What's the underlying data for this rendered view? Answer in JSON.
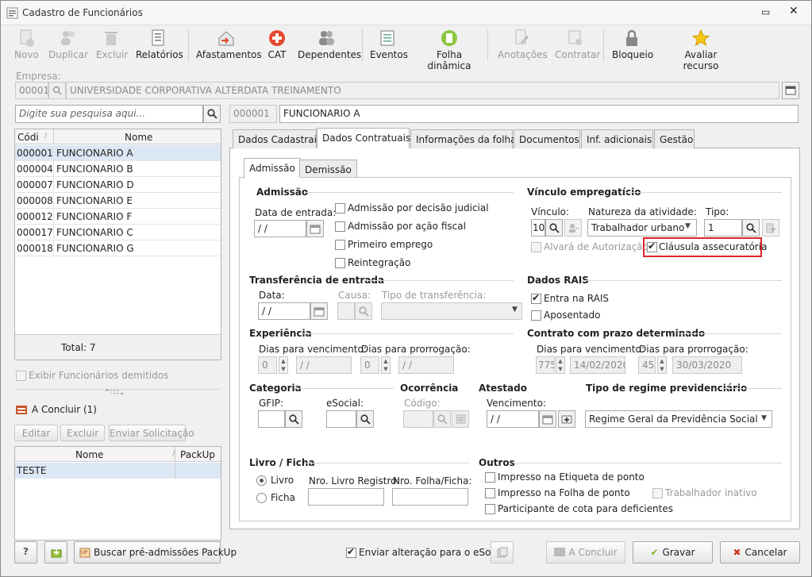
{
  "window": {
    "title": "Cadastro de Funcionários"
  },
  "toolbar": [
    {
      "label": "Novo",
      "icon": "new-document-icon",
      "enabled": false
    },
    {
      "label": "Duplicar",
      "icon": "users-icon",
      "enabled": false
    },
    {
      "label": "Excluir",
      "icon": "trash-icon",
      "enabled": false
    },
    {
      "label": "Relatórios",
      "icon": "report-icon",
      "enabled": true
    },
    {
      "label": "Afastamentos",
      "icon": "house-arrow-icon",
      "enabled": true
    },
    {
      "label": "CAT",
      "icon": "medical-cross-icon",
      "enabled": true
    },
    {
      "label": "Dependentes",
      "icon": "people-icon",
      "enabled": true
    },
    {
      "label": "Eventos",
      "icon": "list-icon",
      "enabled": true
    },
    {
      "label": "Folha dinâmica",
      "icon": "refresh-sheet-icon",
      "enabled": true
    },
    {
      "label": "Anotações",
      "icon": "notes-icon",
      "enabled": false
    },
    {
      "label": "Contratar",
      "icon": "contract-icon",
      "enabled": false
    },
    {
      "label": "Bloqueio",
      "icon": "lock-icon",
      "enabled": true
    },
    {
      "label": "Avaliar recurso",
      "icon": "star-icon",
      "enabled": true
    }
  ],
  "empresa": {
    "label": "Empresa:",
    "code": "00001",
    "name": "UNIVERSIDADE CORPORATIVA ALTERDATA TREINAMENTO"
  },
  "search": {
    "placeholder": "Digite sua pesquisa aqui..."
  },
  "employee": {
    "code": "000001",
    "name": "FUNCIONARIO A"
  },
  "list": {
    "headers": [
      "Códi",
      "Nome"
    ],
    "rows": [
      [
        "000001",
        "FUNCIONARIO A"
      ],
      [
        "000004",
        "FUNCIONARIO B"
      ],
      [
        "000007",
        "FUNCIONARIO D"
      ],
      [
        "000008",
        "FUNCIONARIO E"
      ],
      [
        "000012",
        "FUNCIONARIO F"
      ],
      [
        "000017",
        "FUNCIONARIO C"
      ],
      [
        "000018",
        "FUNCIONARIO G"
      ]
    ],
    "total": "Total: 7"
  },
  "show_dismissed": "Exibir Funcionários demitidos",
  "aconcluir": {
    "title": "A Concluir (1)",
    "buttons": [
      "Editar",
      "Excluir",
      "Enviar Solicitação"
    ],
    "headers": [
      "Nome",
      "PackUp"
    ],
    "rows": [
      [
        "TESTE",
        ""
      ]
    ]
  },
  "tabs": [
    "Dados Cadastrais",
    "Dados Contratuais",
    "Informações da folha",
    "Documentos",
    "Inf. adicionais",
    "Gestão"
  ],
  "subtabs": [
    "Admissão",
    "Demissão"
  ],
  "admissao": {
    "title": "Admissão",
    "data_entrada_label": "Data de entrada:",
    "data_entrada": " / /",
    "checks": [
      "Admissão por decisão judicial",
      "Admissão por ação fiscal",
      "Primeiro emprego",
      "Reintegração"
    ]
  },
  "vinculo": {
    "title": "Vínculo empregatício",
    "vinculo_label": "Vínculo:",
    "vinculo_value": "10",
    "natureza_label": "Natureza da atividade:",
    "natureza_value": "Trabalhador urbano",
    "tipo_label": "Tipo:",
    "tipo_value": "1",
    "alvara": "Alvará de Autorização",
    "clausula": "Cláusula assecuratória"
  },
  "transferencia": {
    "title": "Transferência de entrada",
    "data_label": "Data:",
    "data_value": " / /",
    "causa_label": "Causa:",
    "tipo_label": "Tipo de transferência:"
  },
  "rais": {
    "title": "Dados RAIS",
    "entra": "Entra na RAIS",
    "aposentado": "Aposentado"
  },
  "experiencia": {
    "title": "Experiência",
    "venc_label": "Dias para vencimento:",
    "prorr_label": "Dias para prorrogação:",
    "venc_days": "0",
    "venc_date": " / /",
    "prorr_days": "0",
    "prorr_date": " / /"
  },
  "contrato": {
    "title": "Contrato com prazo determinado",
    "venc_label": "Dias para vencimento:",
    "prorr_label": "Dias para prorrogação:",
    "venc_days": "775",
    "venc_date": "14/02/2020",
    "prorr_days": "45",
    "prorr_date": "30/03/2020"
  },
  "categoria": {
    "title": "Categoria",
    "gfip": "GFIP:",
    "esocial": "eSocial:"
  },
  "ocorrencia": {
    "title": "Ocorrência",
    "codigo": "Código:"
  },
  "atestado": {
    "title": "Atestado",
    "venc_label": "Vencimento:",
    "venc_value": " / /"
  },
  "regime": {
    "title": "Tipo de regime previdenciário",
    "value": "Regime Geral da Previdência Social (RGP"
  },
  "livro": {
    "title": "Livro / Ficha",
    "livro": "Livro",
    "ficha": "Ficha",
    "reg_label": "Nro. Livro Registro:",
    "folha_label": "Nro. Folha/Ficha:"
  },
  "outros": {
    "title": "Outros",
    "etiqueta": "Impresso na Etiqueta de ponto",
    "folha": "Impresso na Folha de ponto",
    "inativo": "Trabalhador inativo",
    "cota": "Participante de cota para deficientes"
  },
  "footer": {
    "help": "?",
    "buscar": "Buscar pré-admissões PackUp",
    "enviar": "Enviar alteração para o eSocial",
    "aconcluir": "A Concluir",
    "gravar": "Gravar",
    "cancelar": "Cancelar"
  },
  "colors": {
    "highlight": "#e0242b",
    "selection": "#dce7f4"
  }
}
